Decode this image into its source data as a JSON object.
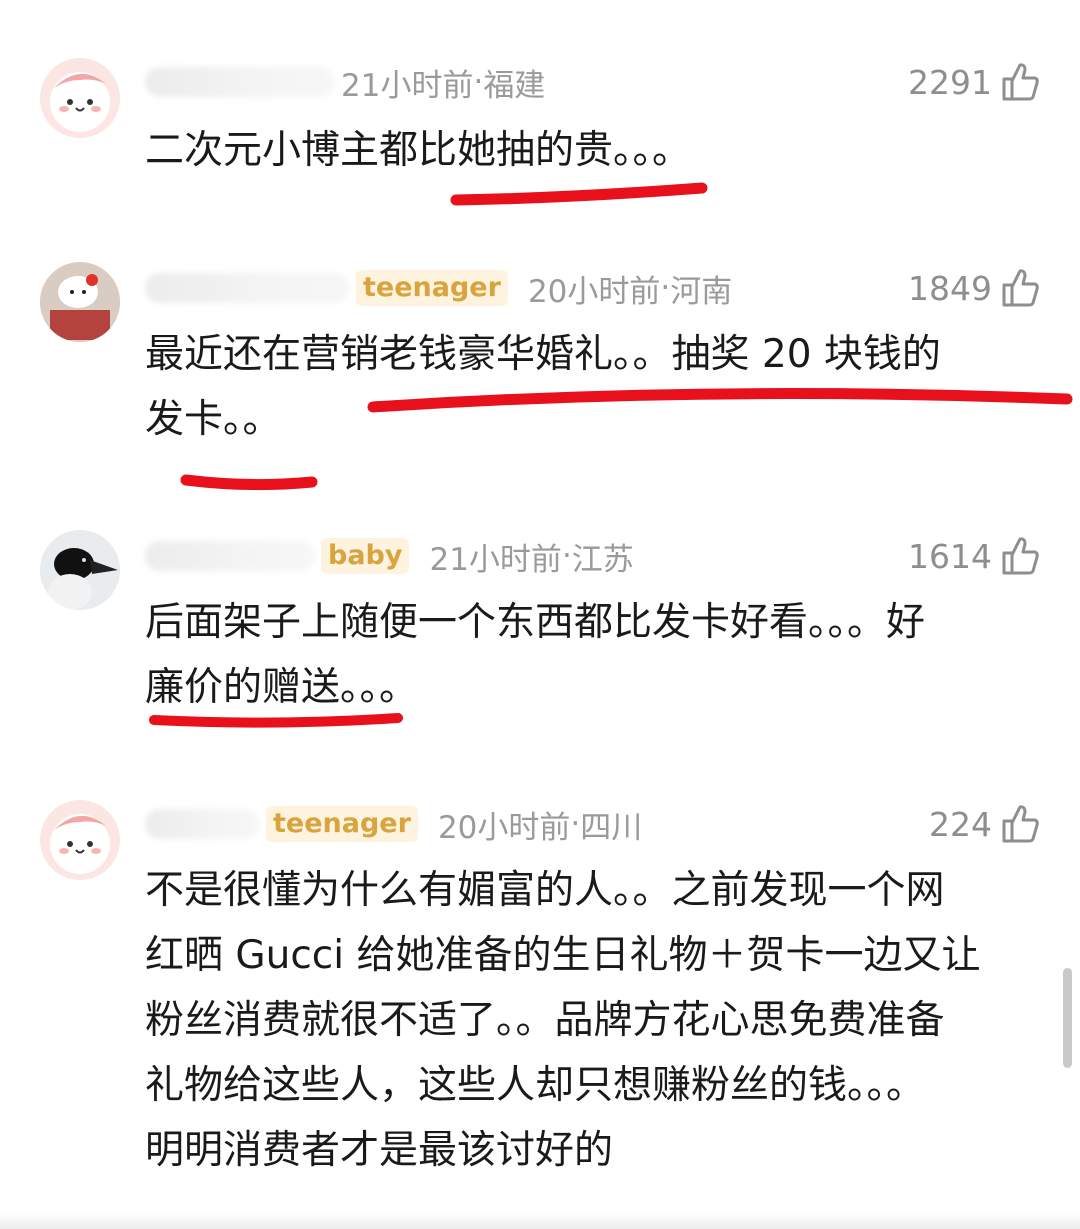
{
  "comments": [
    {
      "badge": "",
      "time": "21小时前",
      "location": "福建",
      "likes": "2291",
      "lines": [
        "二次元小博主都比她抽的贵。。。"
      ]
    },
    {
      "badge": "teenager",
      "time": "20小时前",
      "location": "河南",
      "likes": "1849",
      "lines": [
        "最近还在营销老钱豪华婚礼。。抽奖 20 块钱的",
        "发卡。。"
      ]
    },
    {
      "badge": "baby",
      "time": "21小时前",
      "location": "江苏",
      "likes": "1614",
      "lines": [
        "后面架子上随便一个东西都比发卡好看。。。好",
        "廉价的赠送。。。"
      ]
    },
    {
      "badge": "teenager",
      "time": "20小时前",
      "location": "四川",
      "likes": "224",
      "lines": [
        "不是很懂为什么有媚富的人。。之前发现一个网",
        "红晒 Gucci 给她准备的生日礼物＋贺卡一边又让",
        "粉丝消费就很不适了。。品牌方花心思免费准备",
        "礼物给这些人，这些人却只想赚粉丝的钱。。。",
        "明明消费者才是最该讨好的"
      ]
    }
  ],
  "separator": " · ",
  "colors": {
    "underline": "#e8101a",
    "meta": "#9a9a9a",
    "badge_text": "#d9a33d",
    "badge_bg": "#fdf3de"
  },
  "icons": {
    "like": "thumbs-up-icon"
  }
}
